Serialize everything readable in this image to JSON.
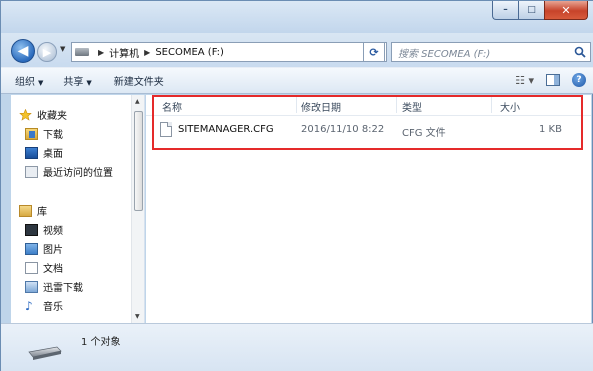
{
  "window": {
    "caption_buttons": {
      "minimize": "–",
      "maximize": "□",
      "close": "✕"
    }
  },
  "nav": {
    "breadcrumbs": [
      "计算机",
      "SECOMEA (F:)"
    ],
    "search_placeholder": "搜索 SECOMEA (F:)"
  },
  "toolbar": {
    "organize": "组织",
    "share": "共享",
    "new_folder": "新建文件夹"
  },
  "sidebar": {
    "favorites": {
      "label": "收藏夹",
      "items": [
        "下载",
        "桌面",
        "最近访问的位置"
      ]
    },
    "libraries": {
      "label": "库",
      "items": [
        "视频",
        "图片",
        "文档",
        "迅雷下载",
        "音乐"
      ]
    }
  },
  "columns": {
    "name": "名称",
    "date": "修改日期",
    "type": "类型",
    "size": "大小"
  },
  "files": [
    {
      "name": "SITEMANAGER.CFG",
      "date": "2016/11/10 8:22",
      "type": "CFG 文件",
      "size": "1 KB"
    }
  ],
  "status": {
    "count": "1 个对象"
  },
  "colors": {
    "highlight_border": "#e52a2a",
    "window_frame": "#bfd5ea"
  }
}
